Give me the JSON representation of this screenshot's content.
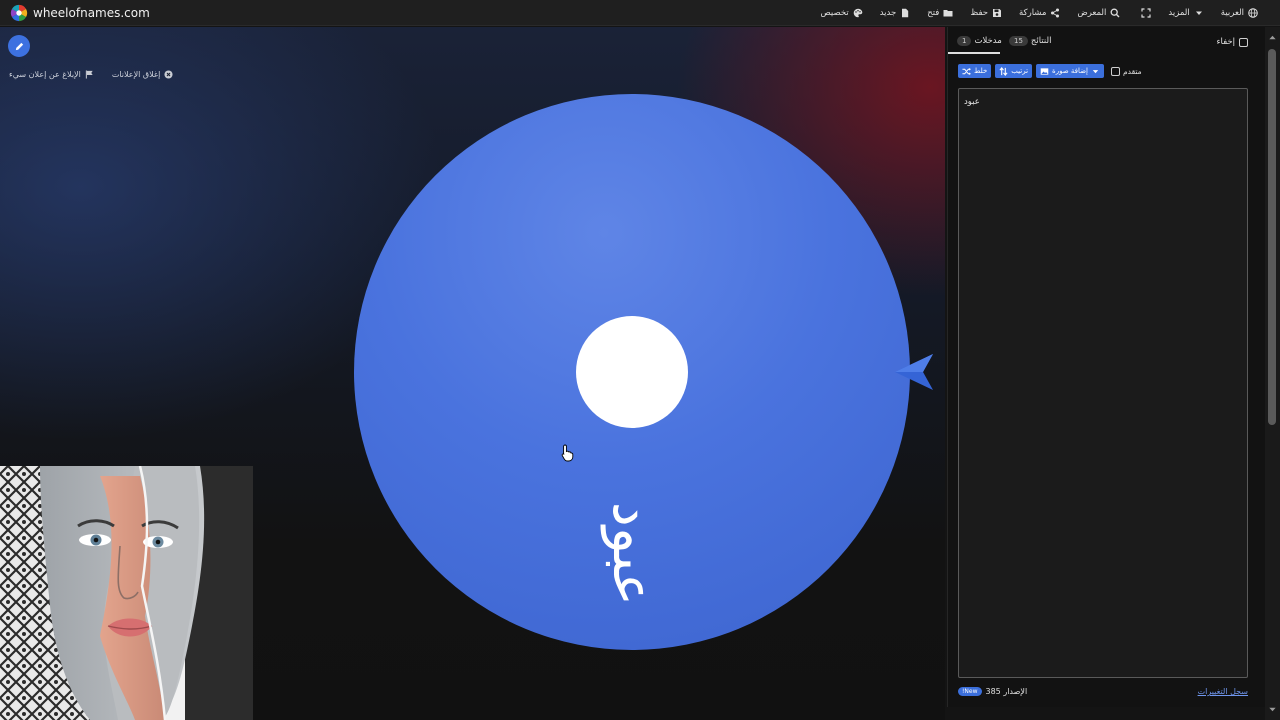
{
  "brand": {
    "name": "wheelofnames.com"
  },
  "menu": [
    {
      "label": "العربية",
      "icon": "globe-icon"
    },
    {
      "label": "المزيد",
      "icon": "caret-down-icon"
    },
    {
      "label": "",
      "icon": "fullscreen-icon"
    },
    {
      "label": "المعرض",
      "icon": "search-icon"
    },
    {
      "label": "مشاركة",
      "icon": "share-icon"
    },
    {
      "label": "حفظ",
      "icon": "save-icon"
    },
    {
      "label": "فتح",
      "icon": "folder-icon"
    },
    {
      "label": "جديد",
      "icon": "new-file-icon"
    },
    {
      "label": "تخصيص",
      "icon": "palette-icon"
    }
  ],
  "stage": {
    "ad_links": {
      "close_ads": "إغلاق الإعلانات",
      "report_ad": "الإبلاغ عن إعلان سيء"
    },
    "wheel": {
      "segment_label": "عبود",
      "colors": {
        "segment": "#4a73de",
        "hub": "#ffffff",
        "pointer": "#3564d6"
      }
    },
    "video_thumbnail": "face-portrait-image"
  },
  "panel": {
    "hide_label": "إخفاء",
    "tabs": {
      "entries": {
        "label": "مدخلات",
        "count": "1"
      },
      "results": {
        "label": "النتائج",
        "count": "15"
      }
    },
    "toolbar": {
      "shuffle": "خلط",
      "sort": "ترتيب",
      "add_image": "إضافة صورة",
      "advanced": "متقدم"
    },
    "entries": [
      "عبود"
    ],
    "footer": {
      "version": "الإصدار 385",
      "new_badge": "New!",
      "changelog": "سجل التغييرات"
    }
  },
  "colors": {
    "accent": "#3b6fdc",
    "panel_bg": "#121212",
    "topbar_bg": "#1f1f1f"
  }
}
